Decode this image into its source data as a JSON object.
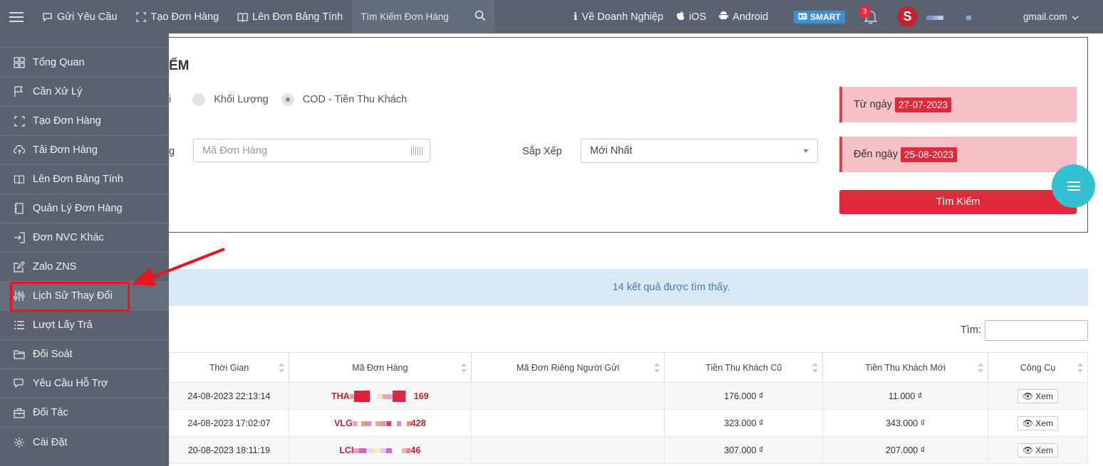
{
  "topbar": {
    "nav": [
      {
        "label": "Gửi Yêu Cầu",
        "icon": "chat-icon"
      },
      {
        "label": "Tạo Đơn Hàng",
        "icon": "expand-icon"
      },
      {
        "label": "Lên Đơn Bảng Tính",
        "icon": "book-icon"
      }
    ],
    "search_placeholder": "Tìm Kiếm Đơn Hàng",
    "right": [
      {
        "label": "Về Doanh Nghiệp",
        "icon": "info-icon"
      },
      {
        "label": "iOS",
        "icon": "apple-icon"
      },
      {
        "label": "Android",
        "icon": "android-icon"
      }
    ],
    "smart_label": "SMART",
    "notification_count": "3",
    "logo_letter": "S",
    "email": "gmail.com"
  },
  "sidebar": {
    "items": [
      {
        "label": "Tổng Quan",
        "icon": "grid-icon"
      },
      {
        "label": "Cần Xử Lý",
        "icon": "flag-icon"
      },
      {
        "label": "Tạo Đơn Hàng",
        "icon": "expand-icon"
      },
      {
        "label": "Tải Đơn Hàng",
        "icon": "cloud-upload-icon"
      },
      {
        "label": "Lên Đơn Bảng Tính",
        "icon": "book-icon"
      },
      {
        "label": "Quản Lý Đơn Hàng",
        "icon": "notebook-icon"
      },
      {
        "label": "Đơn NVC Khác",
        "icon": "sign-in-icon"
      },
      {
        "label": "Zalo ZNS",
        "icon": "edit-icon"
      },
      {
        "label": "Lịch Sử Thay Đổi",
        "icon": "sliders-icon"
      },
      {
        "label": "Lượt Lấy Trả",
        "icon": "list-icon"
      },
      {
        "label": "Đối Soát",
        "icon": "folder-icon"
      },
      {
        "label": "Yêu Cầu Hỗ Trợ",
        "icon": "chat-icon"
      },
      {
        "label": "Đối Tác",
        "icon": "briefcase-icon"
      },
      {
        "label": "Cài Đặt",
        "icon": "gear-icon"
      }
    ]
  },
  "search_panel": {
    "title_fragment": "ẾM",
    "radio_fragment": "i",
    "radio_options": [
      {
        "label": "Khối Lượng",
        "checked": false
      },
      {
        "label": "COD - Tiền Thu Khách",
        "checked": true
      }
    ],
    "field_fragment": "g",
    "order_code_placeholder": "Mã Đơn Hàng",
    "sort_label": "Sắp Xếp",
    "sort_value": "Mới Nhất",
    "from_label": "Từ ngày",
    "from_date": "27-07-2023",
    "to_label": "Đến ngày",
    "to_date": "25-08-2023",
    "search_button": "Tìm Kiếm"
  },
  "results": {
    "summary": "14 kết quả được tìm thấy.",
    "find_label": "Tìm:",
    "columns": [
      "Thời Gian",
      "Mã Đơn Hàng",
      "Mã Đơn Riêng Người Gửi",
      "Tiền Thu Khách Cũ",
      "Tiền Thu Khách Mới",
      "Công Cụ"
    ],
    "rows": [
      {
        "time": "24-08-2023 22:13:14",
        "code_prefix": "THA",
        "code_suffix": "169",
        "sender_code": "",
        "old_cod": "176.000 ₫",
        "new_cod": "11.000 ₫",
        "action": "Xem"
      },
      {
        "time": "24-08-2023 17:02:07",
        "code_prefix": "VLG",
        "code_suffix": "428",
        "sender_code": "",
        "old_cod": "323.000 ₫",
        "new_cod": "343.000 ₫",
        "action": "Xem"
      },
      {
        "time": "20-08-2023 18:11:19",
        "code_prefix": "LCI",
        "code_suffix": "46",
        "sender_code": "",
        "old_cod": "307.000 ₫",
        "new_cod": "207.000 ₫",
        "action": "Xem"
      }
    ]
  },
  "colors": {
    "accent_red": "#e0293a",
    "sidebar_bg": "#5a6270",
    "info_blue": "#3a7fc2",
    "fab": "#34c0d0"
  }
}
